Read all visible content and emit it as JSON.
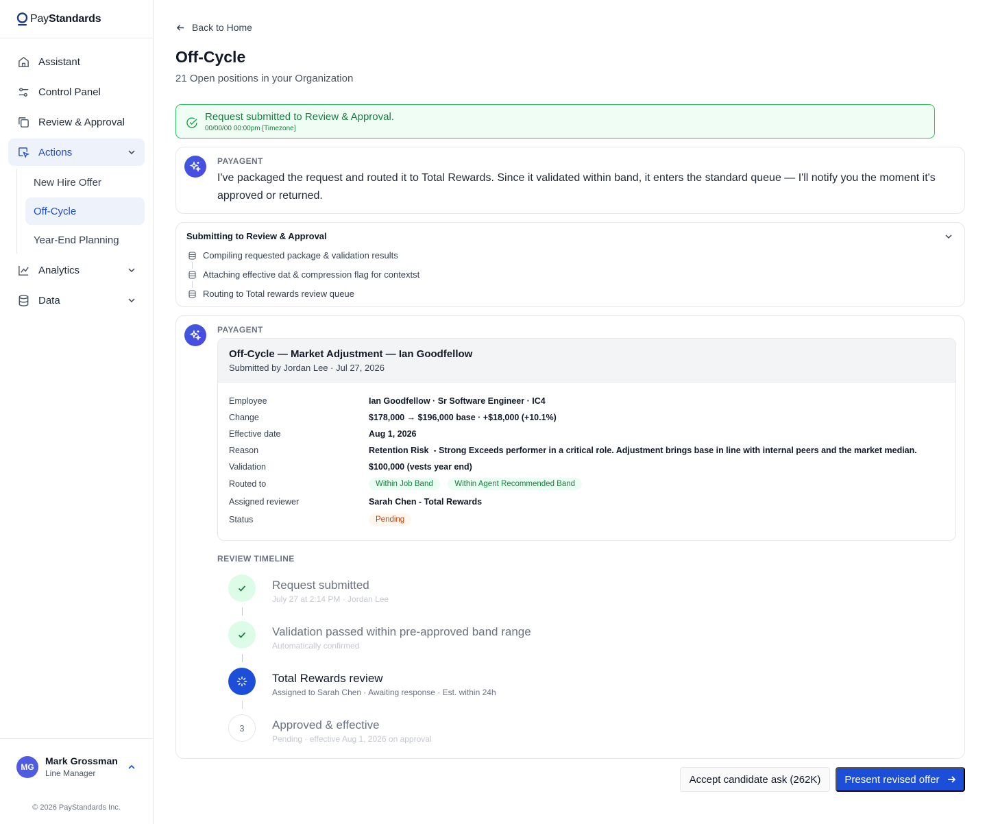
{
  "brand": {
    "name_prefix": "Pay",
    "name_suffix": "Standards"
  },
  "sidebar": {
    "items": [
      {
        "label": "Assistant",
        "icon": "home-icon"
      },
      {
        "label": "Control Panel",
        "icon": "sliders-icon"
      },
      {
        "label": "Review & Approval",
        "icon": "copy-icon"
      },
      {
        "label": "Actions",
        "icon": "cursor-icon",
        "active": true
      },
      {
        "label": "Analytics",
        "icon": "chart-icon"
      },
      {
        "label": "Data",
        "icon": "database-icon"
      }
    ],
    "sub_items": [
      {
        "label": "New Hire Offer"
      },
      {
        "label": "Off-Cycle",
        "active": true
      },
      {
        "label": "Year-End Planning"
      }
    ],
    "user": {
      "initials": "MG",
      "name": "Mark Grossman",
      "role": "Line Manager"
    },
    "copyright": "© 2026 PayStandards Inc."
  },
  "main": {
    "back_label": "Back to Home",
    "title": "Off-Cycle",
    "subtitle": "21 Open positions in your Organization",
    "banner": {
      "title": "Request submitted to Review & Approval.",
      "time": "00/00/00 00:00pm [Timezone]"
    },
    "message1": {
      "agent": "PAYAGENT",
      "text": "I've packaged the request and routed it to Total Rewards. Since it validated within band, it enters the standard queue — I'll notify you the moment it's approved or returned."
    },
    "steps": {
      "title": "Submitting to Review & Approval",
      "items": [
        "Compiling requested package & validation results",
        "Attaching effective dat & compression flag for contextst",
        "Routing to Total rewards review queue"
      ]
    },
    "message2": {
      "agent": "PAYAGENT",
      "request": {
        "title": "Off-Cycle — Market Adjustment — Ian Goodfellow",
        "submitted": "Submitted by Jordan Lee · Jul 27, 2026",
        "fields": {
          "employee_k": "Employee",
          "employee_v": "Ian Goodfellow · Sr Software Engineer · IC4",
          "change_k": "Change",
          "change_v": "$178,000 → $196,000 base · +$18,000 (+10.1%)",
          "effective_k": "Effective date",
          "effective_v": "Aug 1, 2026",
          "reason_k": "Reason",
          "reason_v": "Retention Risk  - Strong Exceeds performer in a critical role. Adjustment brings base in line with internal peers and the market median.",
          "validation_k": "Validation",
          "validation_v": "$100,000 (vests year end)",
          "routed_k": "Routed to",
          "routed_tag1": "Within Job Band",
          "routed_tag2": "Within Agent Recommended Band",
          "reviewer_k": "Assigned reviewer",
          "reviewer_v": "Sarah Chen - Total Rewards",
          "status_k": "Status",
          "status_v": "Pending"
        }
      },
      "timeline": {
        "title": "REVIEW TIMELINE",
        "items": [
          {
            "head": "Request submitted",
            "sub": "July 27 at 2:14 PM · Jordan Lee",
            "state": "done"
          },
          {
            "head": "Validation passed within pre-approved band range",
            "sub": "Automatically confirmed",
            "state": "done"
          },
          {
            "head": "Total Rewards review",
            "sub": "Assigned to Sarah Chen · Awaiting response · Est. within 24h",
            "state": "active"
          },
          {
            "head": "Approved & effective",
            "sub": "Pending · effective Aug 1, 2026 on approval",
            "state": "pending",
            "number": "3"
          }
        ]
      }
    },
    "actions": {
      "secondary": "Accept candidate ask (262K)",
      "primary": "Present revised offer"
    }
  },
  "colors": {
    "accent": "#1d4ed8",
    "success": "#22c55e",
    "warning": "#c2410c"
  }
}
